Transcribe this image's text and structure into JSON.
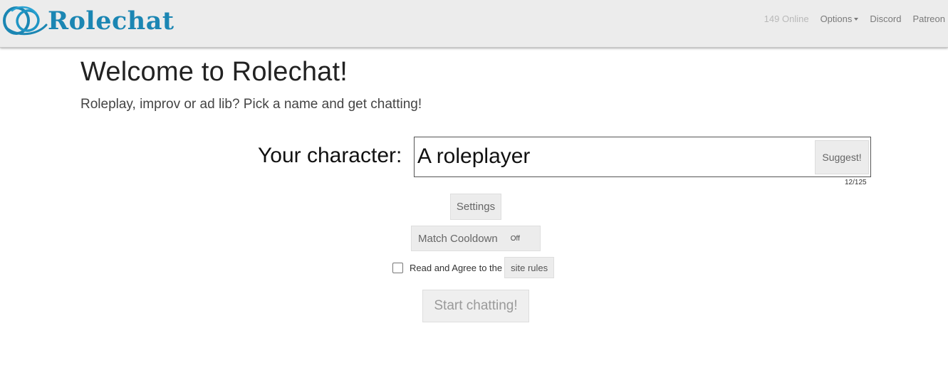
{
  "navbar": {
    "brand": "Rolechat",
    "online": "149 Online",
    "options": "Options",
    "discord": "Discord",
    "patreon": "Patreon"
  },
  "main": {
    "title": "Welcome to Rolechat!",
    "subtitle": "Roleplay, improv or ad lib? Pick a name and get chatting!",
    "character_label": "Your character:",
    "character_value": "A roleplayer",
    "suggest": "Suggest!",
    "char_count": "12/125",
    "settings": "Settings",
    "match_cooldown": "Match Cooldown",
    "match_cooldown_value": "Off",
    "rules_text": "Read and Agree to the",
    "rules_link": "site rules",
    "rules_checked": false,
    "start": "Start chatting!"
  },
  "colors": {
    "brand": "#1b86b3",
    "navbar_bg": "#ececec",
    "button_bg": "#ececec"
  }
}
